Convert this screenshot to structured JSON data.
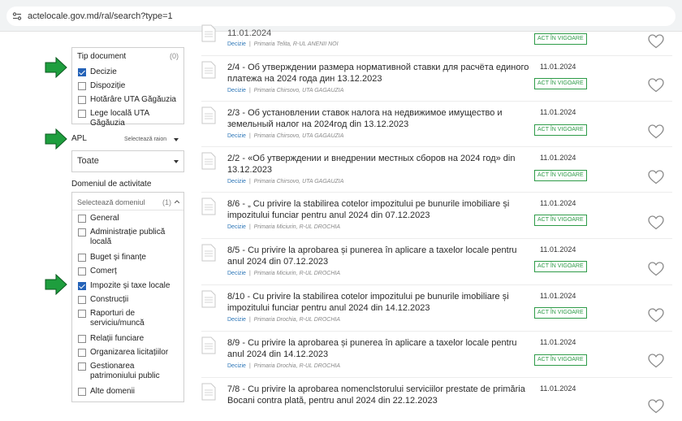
{
  "browser": {
    "url": "actelocale.gov.md/ral/search?type=1"
  },
  "filters": {
    "tip_document": {
      "title": "Tip document",
      "count": "(0)",
      "options": [
        {
          "label": "Decizie",
          "checked": true
        },
        {
          "label": "Dispoziție",
          "checked": false
        },
        {
          "label": "Hotărâre UTA Găgăuzia",
          "checked": false
        },
        {
          "label": "Lege locală UTA Găgăuzia",
          "checked": false
        }
      ]
    },
    "apl": {
      "label": "APL",
      "select_raion": "Selectează raion",
      "value": "Toate"
    },
    "domeniu": {
      "title": "Domeniul de activitate",
      "select_label": "Selectează domeniul",
      "count": "(1)",
      "options": [
        {
          "label": "General",
          "checked": false
        },
        {
          "label": "Administrație publică locală",
          "checked": false
        },
        {
          "label": "Buget și finanțe",
          "checked": false
        },
        {
          "label": "Comerț",
          "checked": false
        },
        {
          "label": "Impozite și taxe locale",
          "checked": true
        },
        {
          "label": "Construcții",
          "checked": false
        },
        {
          "label": "Raporturi de serviciu/muncă",
          "checked": false
        },
        {
          "label": "Relații funciare",
          "checked": false
        },
        {
          "label": "Organizarea licitațiilor",
          "checked": false
        },
        {
          "label": "Gestionarea patrimoniului public",
          "checked": false
        },
        {
          "label": "Alte domenii",
          "checked": false
        }
      ]
    }
  },
  "colors": {
    "accent": "#2563b8",
    "arrow_green": "#1e9e3e",
    "badge_green": "#2e9b48"
  },
  "results": [
    {
      "title": "11.01.2024",
      "type": "Decizie",
      "source": "Primaria Telita, R-UL ANENII NOI",
      "date": "",
      "status": "ACT ÎN VIGOARE"
    },
    {
      "title": "2/4 - Об утверждении размера нормативной ставки для расчёта единого платежа на 2024 года дин 13.12.2023",
      "type": "Decizie",
      "source": "Primaria Chirsovo, UTA GAGAUZIA",
      "date": "11.01.2024",
      "status": "ACT ÎN VIGOARE"
    },
    {
      "title": "2/3 - Об установлении ставок налога на недвижимое имущество и земельный налог на 2024год din 13.12.2023",
      "type": "Decizie",
      "source": "Primaria Chirsovo, UTA GAGAUZIA",
      "date": "11.01.2024",
      "status": "ACT ÎN VIGOARE"
    },
    {
      "title": "2/2 - «Об утверждении и внедрении местных сборов на 2024 год» din 13.12.2023",
      "type": "Decizie",
      "source": "Primaria Chirsovo, UTA GAGAUZIA",
      "date": "11.01.2024",
      "status": "ACT ÎN VIGOARE"
    },
    {
      "title": "8/6 - „ Cu privire la stabilirea cotelor impozitului pe bunurile imobiliare și impozitului funciar pentru anul 2024 din 07.12.2023",
      "type": "Decizie",
      "source": "Primaria Miciurin, R-UL DROCHIA",
      "date": "11.01.2024",
      "status": "ACT ÎN VIGOARE"
    },
    {
      "title": "8/5 - Cu privire la aprobarea și punerea în aplicare a taxelor locale pentru anul 2024 din 07.12.2023",
      "type": "Decizie",
      "source": "Primaria Miciurin, R-UL DROCHIA",
      "date": "11.01.2024",
      "status": "ACT ÎN VIGOARE"
    },
    {
      "title": "8/10 - Cu privire la stabilirea cotelor impozitului pe bunurile imobiliare și impozitului funciar pentru anul 2024 din 14.12.2023",
      "type": "Decizie",
      "source": "Primaria Drochia, R-UL DROCHIA",
      "date": "11.01.2024",
      "status": "ACT ÎN VIGOARE"
    },
    {
      "title": "8/9 - Cu privire la aprobarea și punerea în aplicare a taxelor locale pentru anul 2024 din 14.12.2023",
      "type": "Decizie",
      "source": "Primaria Drochia, R-UL DROCHIA",
      "date": "11.01.2024",
      "status": "ACT ÎN VIGOARE"
    },
    {
      "title": "7/8 - Cu privire la aprobarea nomenclstorului serviciilor prestate de primăria Bocani contra plată, pentru anul 2024 din 22.12.2023",
      "type": "",
      "source": "",
      "date": "11.01.2024",
      "status": ""
    }
  ]
}
